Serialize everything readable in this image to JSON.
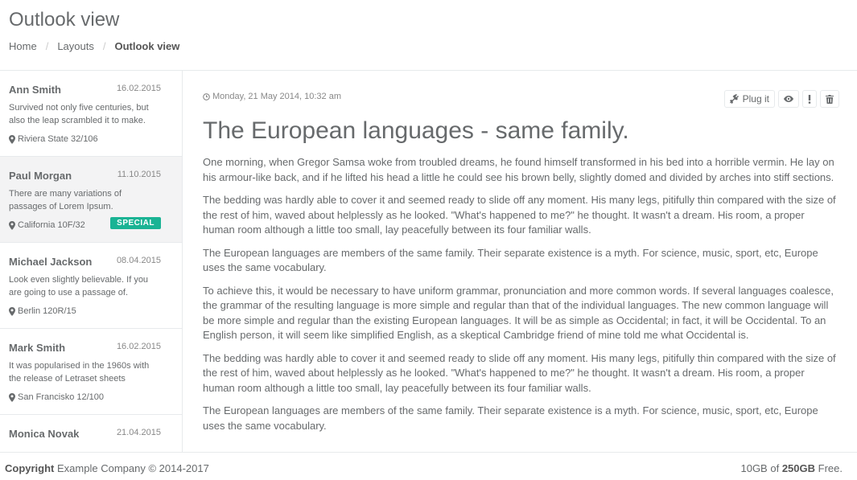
{
  "header": {
    "title": "Outlook view",
    "breadcrumb": [
      "Home",
      "Layouts",
      "Outlook view"
    ]
  },
  "sidebar": {
    "items": [
      {
        "name": "Ann Smith",
        "date": "16.02.2015",
        "preview": "Survived not only five centuries, but also the leap scrambled it to make.",
        "location": "Riviera State 32/106",
        "badge": ""
      },
      {
        "name": "Paul Morgan",
        "date": "11.10.2015",
        "preview": "There are many variations of passages of Lorem Ipsum.",
        "location": "California 10F/32",
        "badge": "SPECIAL"
      },
      {
        "name": "Michael Jackson",
        "date": "08.04.2015",
        "preview": "Look even slightly believable. If you are going to use a passage of.",
        "location": "Berlin 120R/15",
        "badge": ""
      },
      {
        "name": "Mark Smith",
        "date": "16.02.2015",
        "preview": "It was popularised in the 1960s with the release of Letraset sheets",
        "location": "San Francisko 12/100",
        "badge": ""
      },
      {
        "name": "Monica Novak",
        "date": "21.04.2015",
        "preview": "",
        "location": "",
        "badge": ""
      }
    ]
  },
  "article": {
    "date": "Monday, 21 May 2014, 10:32 am",
    "title": "The European languages - same family.",
    "paragraphs": [
      "One morning, when Gregor Samsa woke from troubled dreams, he found himself transformed in his bed into a horrible vermin. He lay on his armour-like back, and if he lifted his head a little he could see his brown belly, slightly domed and divided by arches into stiff sections.",
      "The bedding was hardly able to cover it and seemed ready to slide off any moment. His many legs, pitifully thin compared with the size of the rest of him, waved about helplessly as he looked. \"What's happened to me?\" he thought. It wasn't a dream. His room, a proper human room although a little too small, lay peacefully between its four familiar walls.",
      "The European languages are members of the same family. Their separate existence is a myth. For science, music, sport, etc, Europe uses the same vocabulary.",
      "To achieve this, it would be necessary to have uniform grammar, pronunciation and more common words. If several languages coalesce, the grammar of the resulting language is more simple and regular than that of the individual languages. The new common language will be more simple and regular than the existing European languages. It will be as simple as Occidental; in fact, it will be Occidental. To an English person, it will seem like simplified English, as a skeptical Cambridge friend of mine told me what Occidental is.",
      "The bedding was hardly able to cover it and seemed ready to slide off any moment. His many legs, pitifully thin compared with the size of the rest of him, waved about helplessly as he looked. \"What's happened to me?\" he thought. It wasn't a dream. His room, a proper human room although a little too small, lay peacefully between its four familiar walls.",
      "The European languages are members of the same family. Their separate existence is a myth. For science, music, sport, etc, Europe uses the same vocabulary."
    ],
    "toolbar": {
      "plug_label": "Plug it",
      "icons": [
        "plug-icon",
        "eye-icon",
        "exclamation-icon",
        "trash-icon"
      ]
    }
  },
  "footer": {
    "copyright_bold": "Copyright",
    "copyright_text": "Example Company © 2014-2017",
    "storage_used": "10GB",
    "storage_of": "of",
    "storage_total": "250GB",
    "storage_suffix": "Free."
  },
  "colors": {
    "accent": "#1ab394",
    "text": "#676a6c",
    "border": "#e7eaec",
    "selected_bg": "#f3f3f4"
  }
}
